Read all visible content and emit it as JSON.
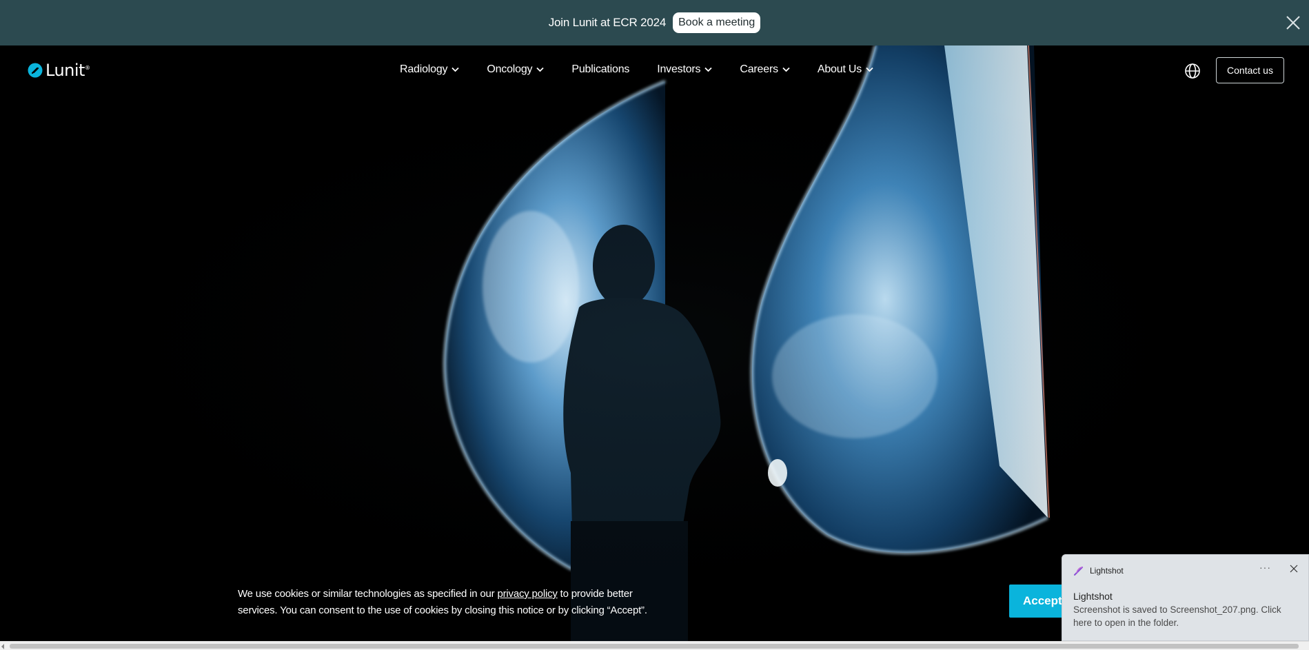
{
  "banner": {
    "text": "Join Lunit at ECR 2024",
    "button_label": "Book a meeting"
  },
  "brand": {
    "name": "Lunit",
    "trademark": "®",
    "accent_color": "#0ab4dc"
  },
  "nav": {
    "items": [
      {
        "label": "Radiology",
        "has_dropdown": true
      },
      {
        "label": "Oncology",
        "has_dropdown": true
      },
      {
        "label": "Publications",
        "has_dropdown": false
      },
      {
        "label": "Investors",
        "has_dropdown": true
      },
      {
        "label": "Careers",
        "has_dropdown": true
      },
      {
        "label": "About Us",
        "has_dropdown": true
      }
    ],
    "language_icon": "globe-icon",
    "contact_label": "Contact us"
  },
  "cookie": {
    "text_before": "We use cookies or similar technologies as specified in our ",
    "link_label": "privacy policy",
    "text_after": " to provide better services. You can consent to the use of cookies by closing this notice or by clicking “Accept”.",
    "accept_label": "Accept"
  },
  "toast": {
    "app_name": "Lightshot",
    "more_label": "···",
    "title": "Lightshot",
    "body": "Screenshot is saved to Screenshot_207.png. Click here to open in the folder."
  }
}
